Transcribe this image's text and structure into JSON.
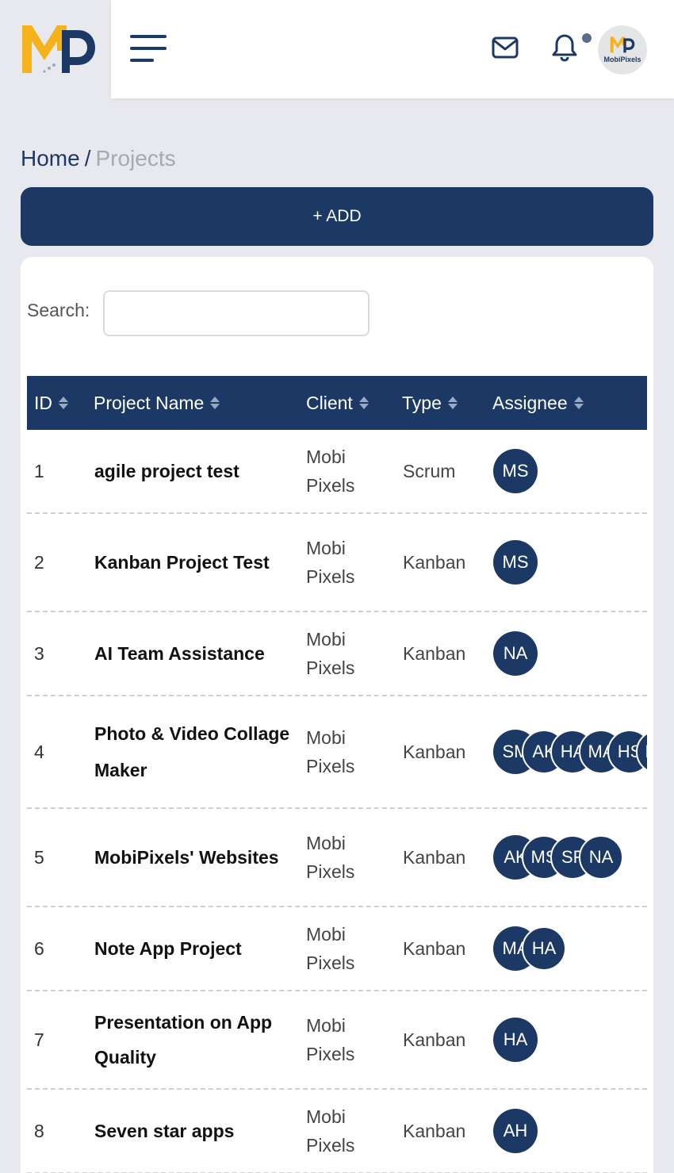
{
  "header": {
    "avatar_label": "MobiPixels"
  },
  "breadcrumb": {
    "home": "Home",
    "separator": "/",
    "current": "Projects"
  },
  "add_button": "+ ADD",
  "search": {
    "label": "Search:",
    "value": ""
  },
  "table": {
    "columns": [
      "ID",
      "Project Name",
      "Client",
      "Type",
      "Assignee"
    ],
    "rows": [
      {
        "id": "1",
        "name": "agile project test",
        "client": "Mobi Pixels",
        "type": "Scrum",
        "assignees": [
          "MS"
        ]
      },
      {
        "id": "2",
        "name": "Kanban Project Test",
        "client": "Mobi Pixels",
        "type": "Kanban",
        "assignees": [
          "MS"
        ]
      },
      {
        "id": "3",
        "name": "AI Team Assistance",
        "client": "Mobi Pixels",
        "type": "Kanban",
        "assignees": [
          "NA"
        ]
      },
      {
        "id": "4",
        "name": "Photo & Video Collage Maker",
        "client": "Mobi Pixels",
        "type": "Kanban",
        "assignees": [
          "SM",
          "AK",
          "HA",
          "MA",
          "HS",
          "MS"
        ]
      },
      {
        "id": "5",
        "name": "MobiPixels' Websites",
        "client": "Mobi Pixels",
        "type": "Kanban",
        "assignees": [
          "AK",
          "MS",
          "SF",
          "NA"
        ]
      },
      {
        "id": "6",
        "name": "Note App Project",
        "client": "Mobi Pixels",
        "type": "Kanban",
        "assignees": [
          "MA",
          "HA"
        ]
      },
      {
        "id": "7",
        "name": "Presentation on App Quality",
        "client": "Mobi Pixels",
        "type": "Kanban",
        "assignees": [
          "HA"
        ]
      },
      {
        "id": "8",
        "name": "Seven star apps",
        "client": "Mobi Pixels",
        "type": "Kanban",
        "assignees": [
          "AH"
        ]
      }
    ]
  },
  "colors": {
    "primary": "#1c3966",
    "accent": "#f5b21a",
    "background": "#e8e9ee"
  }
}
